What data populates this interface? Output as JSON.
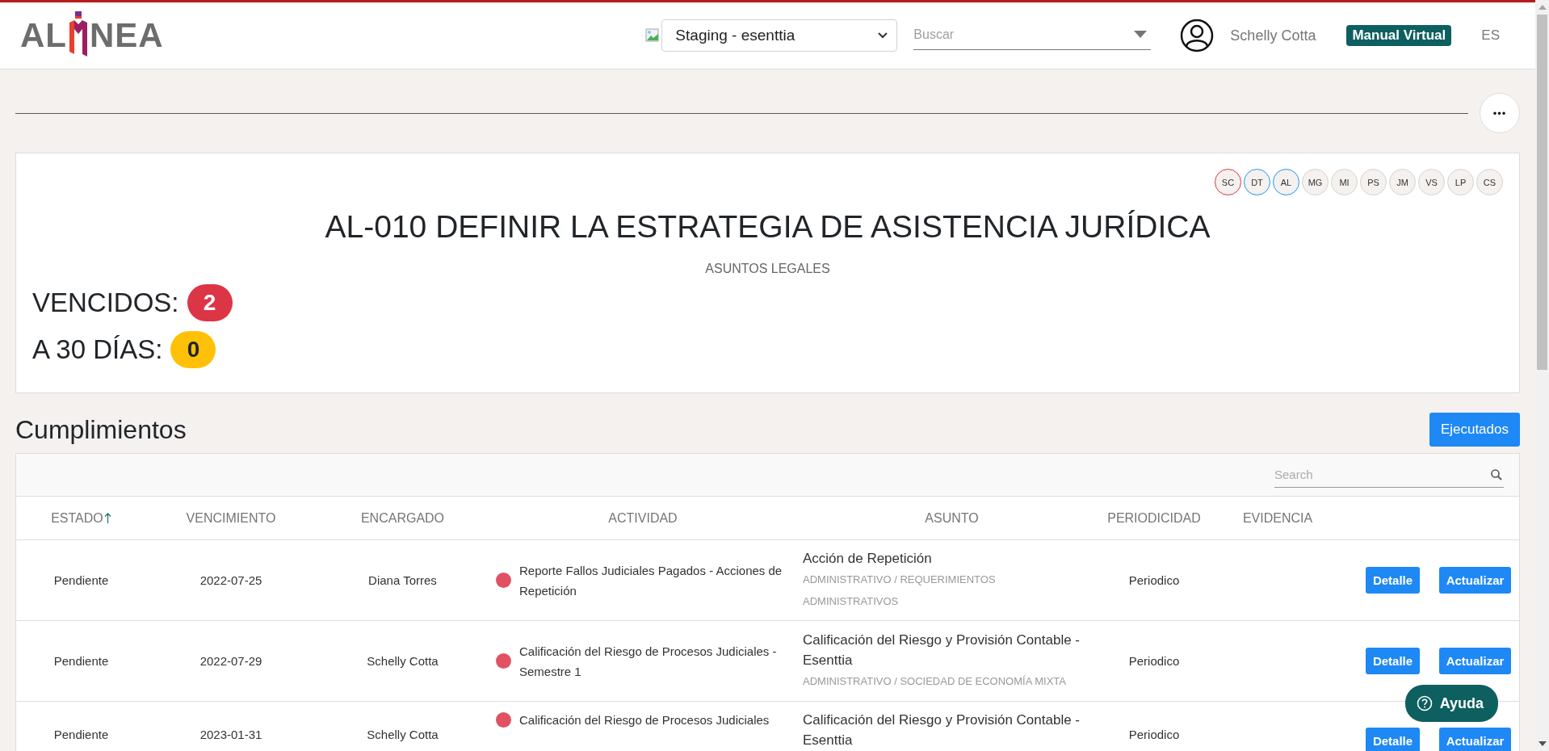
{
  "header": {
    "logo": {
      "start": "AL",
      "end": "NEA"
    },
    "workspace_select": {
      "value": "Staging - esenttia"
    },
    "search": {
      "placeholder": "Buscar"
    },
    "user_name": "Schelly Cotta",
    "manual_button": "Manual Virtual",
    "language": "ES"
  },
  "more_button": "•••",
  "summary": {
    "avatars": [
      {
        "initials": "SC",
        "color": "#dc3545"
      },
      {
        "initials": "DT",
        "color": "#2196f3"
      },
      {
        "initials": "AL",
        "color": "#2196f3"
      },
      {
        "initials": "MG",
        "color": "#d6d2ce"
      },
      {
        "initials": "MI",
        "color": "#d6d2ce"
      },
      {
        "initials": "PS",
        "color": "#d6d2ce"
      },
      {
        "initials": "JM",
        "color": "#d6d2ce"
      },
      {
        "initials": "VS",
        "color": "#d6d2ce"
      },
      {
        "initials": "LP",
        "color": "#d6d2ce"
      },
      {
        "initials": "CS",
        "color": "#d6d2ce"
      }
    ],
    "title": "AL-010 DEFINIR LA ESTRATEGIA DE ASISTENCIA JURÍDICA",
    "subtitle": "ASUNTOS LEGALES",
    "counters": [
      {
        "label": "VENCIDOS:",
        "count": "2",
        "color": "#dc3545"
      },
      {
        "label": "A 30 DÍAS:",
        "count": "0",
        "color": "#ffc107"
      }
    ]
  },
  "section": {
    "title": "Cumplimientos",
    "action_button": "Ejecutados"
  },
  "table": {
    "search": {
      "placeholder": "Search"
    },
    "columns": [
      {
        "label": "ESTADO",
        "sorted": true
      },
      {
        "label": "VENCIMIENTO",
        "sorted": false
      },
      {
        "label": "ENCARGADO",
        "sorted": false
      },
      {
        "label": "ACTIVIDAD",
        "sorted": false
      },
      {
        "label": "ASUNTO",
        "sorted": false
      },
      {
        "label": "PERIODICIDAD",
        "sorted": false
      },
      {
        "label": "EVIDENCIA",
        "sorted": false
      }
    ],
    "rows": [
      {
        "estado": "Pendiente",
        "vencimiento": "2022-07-25",
        "encargado": "Diana Torres",
        "actividad": "Reporte Fallos Judiciales Pagados - Acciones de Repetición",
        "color": "#e05263",
        "asunto": "Acción de Repetición",
        "asunto_path": "ADMINISTRATIVO / REQUERIMIENTOS ADMINISTRATIVOS",
        "periodicidad": "Periodico",
        "buttons": [
          "Detalle",
          "Actualizar"
        ]
      },
      {
        "estado": "Pendiente",
        "vencimiento": "2022-07-29",
        "encargado": "Schelly Cotta",
        "actividad": "Calificación del Riesgo de Procesos Judiciales - Semestre 1",
        "color": "#e05263",
        "asunto": "Calificación del Riesgo y Provisión Contable - Esenttia",
        "asunto_path": "ADMINISTRATIVO / SOCIEDAD DE ECONOMÍA MIXTA",
        "periodicidad": "Periodico",
        "buttons": [
          "Detalle",
          "Actualizar"
        ]
      },
      {
        "estado": "Pendiente",
        "vencimiento": "2023-01-31",
        "encargado": "Schelly Cotta",
        "actividad": "Calificación del Riesgo de Procesos Judiciales",
        "color": "#e05263",
        "asunto": "Calificación del Riesgo y Provisión Contable - Esenttia",
        "periodicidad": "Periodico",
        "buttons": [
          "Detalle",
          "Actualizar"
        ]
      }
    ]
  },
  "help_button": "Ayuda"
}
